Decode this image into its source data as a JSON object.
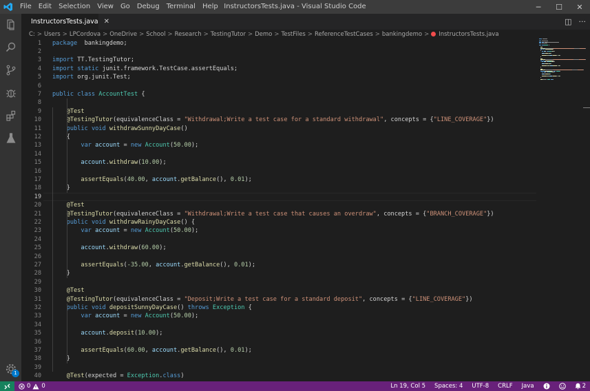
{
  "window": {
    "title": "InstructorsTests.java - Visual Studio Code",
    "menu": [
      "File",
      "Edit",
      "Selection",
      "View",
      "Go",
      "Debug",
      "Terminal",
      "Help"
    ],
    "controls": {
      "minimize": "─",
      "maximize": "☐",
      "close": "✕"
    }
  },
  "activitybar": {
    "icons": [
      "explorer-icon",
      "search-icon",
      "source-control-icon",
      "debug-icon",
      "extensions-icon",
      "testing-flask-icon",
      "manage-gear-icon"
    ],
    "gear_badge": "1"
  },
  "tab": {
    "label": "InstructorsTests.java",
    "close": "✕"
  },
  "editor_actions": {
    "split": "◫",
    "more": "···"
  },
  "breadcrumbs": [
    "C:",
    "Users",
    "LPCordova",
    "OneDrive",
    "School",
    "Research",
    "TestingTutor",
    "Demo",
    "TestFiles",
    "ReferenceTestCases",
    "bankingdemo",
    "InstructorsTests.java"
  ],
  "breadcrumb_separator": ">",
  "editor": {
    "active_line": 19,
    "lines": [
      {
        "n": 1,
        "t": [
          [
            "kw",
            "package"
          ],
          [
            "",
            "  bankingdemo;"
          ]
        ]
      },
      {
        "n": 2,
        "t": []
      },
      {
        "n": 3,
        "t": [
          [
            "kw",
            "import"
          ],
          [
            "",
            " TT.TestingTutor;"
          ]
        ]
      },
      {
        "n": 4,
        "t": [
          [
            "kw",
            "import"
          ],
          [
            "",
            " "
          ],
          [
            "kw",
            "static"
          ],
          [
            "",
            " junit.framework.TestCase.assertEquals;"
          ]
        ]
      },
      {
        "n": 5,
        "t": [
          [
            "kw",
            "import"
          ],
          [
            "",
            " org.junit.Test;"
          ]
        ]
      },
      {
        "n": 6,
        "t": []
      },
      {
        "n": 7,
        "t": [
          [
            "kw",
            "public"
          ],
          [
            "",
            " "
          ],
          [
            "kw",
            "class"
          ],
          [
            "",
            " "
          ],
          [
            "ty",
            "AccountTest"
          ],
          [
            "",
            " {"
          ]
        ]
      },
      {
        "n": 8,
        "t": []
      },
      {
        "n": 9,
        "t": [
          [
            "",
            "    "
          ],
          [
            "ann",
            "@Test"
          ]
        ]
      },
      {
        "n": 10,
        "t": [
          [
            "",
            "    "
          ],
          [
            "ann",
            "@TestingTutor"
          ],
          [
            "",
            "(equivalenceClass = "
          ],
          [
            "str",
            "\"Withdrawal;Write a test case for a standard withdrawal\""
          ],
          [
            "",
            ", concepts = {"
          ],
          [
            "str",
            "\"LINE_COVERAGE\""
          ],
          [
            "",
            "})"
          ]
        ]
      },
      {
        "n": 11,
        "t": [
          [
            "",
            "    "
          ],
          [
            "kw",
            "public"
          ],
          [
            "",
            " "
          ],
          [
            "kw",
            "void"
          ],
          [
            "",
            " "
          ],
          [
            "fn",
            "withdrawSunnyDayCase"
          ],
          [
            "",
            "()"
          ]
        ]
      },
      {
        "n": 12,
        "t": [
          [
            "",
            "    {"
          ]
        ]
      },
      {
        "n": 13,
        "t": [
          [
            "",
            "        "
          ],
          [
            "kw",
            "var"
          ],
          [
            "",
            " "
          ],
          [
            "var",
            "account"
          ],
          [
            "",
            " = "
          ],
          [
            "kw",
            "new"
          ],
          [
            "",
            " "
          ],
          [
            "ty",
            "Account"
          ],
          [
            "",
            "("
          ],
          [
            "num",
            "50.00"
          ],
          [
            "",
            ");"
          ]
        ]
      },
      {
        "n": 14,
        "t": []
      },
      {
        "n": 15,
        "t": [
          [
            "",
            "        "
          ],
          [
            "var",
            "account"
          ],
          [
            "",
            "."
          ],
          [
            "fn",
            "withdraw"
          ],
          [
            "",
            "("
          ],
          [
            "num",
            "10.00"
          ],
          [
            "",
            ");"
          ]
        ]
      },
      {
        "n": 16,
        "t": []
      },
      {
        "n": 17,
        "t": [
          [
            "",
            "        "
          ],
          [
            "fn",
            "assertEquals"
          ],
          [
            "",
            "("
          ],
          [
            "num",
            "40.00"
          ],
          [
            "",
            ", "
          ],
          [
            "var",
            "account"
          ],
          [
            "",
            "."
          ],
          [
            "fn",
            "getBalance"
          ],
          [
            "",
            "(), "
          ],
          [
            "num",
            "0.01"
          ],
          [
            "",
            ");"
          ]
        ]
      },
      {
        "n": 18,
        "t": [
          [
            "",
            "    }"
          ]
        ]
      },
      {
        "n": 19,
        "t": []
      },
      {
        "n": 20,
        "t": [
          [
            "",
            "    "
          ],
          [
            "ann",
            "@Test"
          ]
        ]
      },
      {
        "n": 21,
        "t": [
          [
            "",
            "    "
          ],
          [
            "ann",
            "@TestingTutor"
          ],
          [
            "",
            "(equivalenceClass = "
          ],
          [
            "str",
            "\"Withdrawal;Write a test case that causes an overdraw\""
          ],
          [
            "",
            ", concepts = {"
          ],
          [
            "str",
            "\"BRANCH_COVERAGE\""
          ],
          [
            "",
            "})"
          ]
        ]
      },
      {
        "n": 22,
        "t": [
          [
            "",
            "    "
          ],
          [
            "kw",
            "public"
          ],
          [
            "",
            " "
          ],
          [
            "kw",
            "void"
          ],
          [
            "",
            " "
          ],
          [
            "fn",
            "withdrawRainyDayCase"
          ],
          [
            "",
            "() {"
          ]
        ]
      },
      {
        "n": 23,
        "t": [
          [
            "",
            "        "
          ],
          [
            "kw",
            "var"
          ],
          [
            "",
            " "
          ],
          [
            "var",
            "account"
          ],
          [
            "",
            " = "
          ],
          [
            "kw",
            "new"
          ],
          [
            "",
            " "
          ],
          [
            "ty",
            "Account"
          ],
          [
            "",
            "("
          ],
          [
            "num",
            "50.00"
          ],
          [
            "",
            ");"
          ]
        ]
      },
      {
        "n": 24,
        "t": []
      },
      {
        "n": 25,
        "t": [
          [
            "",
            "        "
          ],
          [
            "var",
            "account"
          ],
          [
            "",
            "."
          ],
          [
            "fn",
            "withdraw"
          ],
          [
            "",
            "("
          ],
          [
            "num",
            "60.00"
          ],
          [
            "",
            ");"
          ]
        ]
      },
      {
        "n": 26,
        "t": []
      },
      {
        "n": 27,
        "t": [
          [
            "",
            "        "
          ],
          [
            "fn",
            "assertEquals"
          ],
          [
            "",
            "("
          ],
          [
            "num",
            "-35.00"
          ],
          [
            "",
            ", "
          ],
          [
            "var",
            "account"
          ],
          [
            "",
            "."
          ],
          [
            "fn",
            "getBalance"
          ],
          [
            "",
            "(), "
          ],
          [
            "num",
            "0.01"
          ],
          [
            "",
            ");"
          ]
        ]
      },
      {
        "n": 28,
        "t": [
          [
            "",
            "    }"
          ]
        ]
      },
      {
        "n": 29,
        "t": []
      },
      {
        "n": 30,
        "t": [
          [
            "",
            "    "
          ],
          [
            "ann",
            "@Test"
          ]
        ]
      },
      {
        "n": 31,
        "t": [
          [
            "",
            "    "
          ],
          [
            "ann",
            "@TestingTutor"
          ],
          [
            "",
            "(equivalenceClass = "
          ],
          [
            "str",
            "\"Deposit;Write a test case for a standard deposit\""
          ],
          [
            "",
            ", concepts = {"
          ],
          [
            "str",
            "\"LINE_COVERAGE\""
          ],
          [
            "",
            "})"
          ]
        ]
      },
      {
        "n": 32,
        "t": [
          [
            "",
            "    "
          ],
          [
            "kw",
            "public"
          ],
          [
            "",
            " "
          ],
          [
            "kw",
            "void"
          ],
          [
            "",
            " "
          ],
          [
            "fn",
            "depositSunnyDayCase"
          ],
          [
            "",
            "() "
          ],
          [
            "kw",
            "throws"
          ],
          [
            "",
            " "
          ],
          [
            "ty",
            "Exception"
          ],
          [
            "",
            " {"
          ]
        ]
      },
      {
        "n": 33,
        "t": [
          [
            "",
            "        "
          ],
          [
            "kw",
            "var"
          ],
          [
            "",
            " "
          ],
          [
            "var",
            "account"
          ],
          [
            "",
            " = "
          ],
          [
            "kw",
            "new"
          ],
          [
            "",
            " "
          ],
          [
            "ty",
            "Account"
          ],
          [
            "",
            "("
          ],
          [
            "num",
            "50.00"
          ],
          [
            "",
            ");"
          ]
        ]
      },
      {
        "n": 34,
        "t": []
      },
      {
        "n": 35,
        "t": [
          [
            "",
            "        "
          ],
          [
            "var",
            "account"
          ],
          [
            "",
            "."
          ],
          [
            "fn",
            "deposit"
          ],
          [
            "",
            "("
          ],
          [
            "num",
            "10.00"
          ],
          [
            "",
            ");"
          ]
        ]
      },
      {
        "n": 36,
        "t": []
      },
      {
        "n": 37,
        "t": [
          [
            "",
            "        "
          ],
          [
            "fn",
            "assertEquals"
          ],
          [
            "",
            "("
          ],
          [
            "num",
            "60.00"
          ],
          [
            "",
            ", "
          ],
          [
            "var",
            "account"
          ],
          [
            "",
            "."
          ],
          [
            "fn",
            "getBalance"
          ],
          [
            "",
            "(), "
          ],
          [
            "num",
            "0.01"
          ],
          [
            "",
            ");"
          ]
        ]
      },
      {
        "n": 38,
        "t": [
          [
            "",
            "    }"
          ]
        ]
      },
      {
        "n": 39,
        "t": []
      },
      {
        "n": 40,
        "t": [
          [
            "",
            "    "
          ],
          [
            "ann",
            "@Test"
          ],
          [
            "",
            "(expected = "
          ],
          [
            "ty",
            "Exception"
          ],
          [
            "",
            "."
          ],
          [
            "kw",
            "class"
          ],
          [
            "",
            ")"
          ]
        ]
      }
    ]
  },
  "statusbar": {
    "errors": "0",
    "warnings": "0",
    "position": "Ln 19, Col 5",
    "spaces": "Spaces: 4",
    "encoding": "UTF-8",
    "eol": "CRLF",
    "language": "Java",
    "notifications": "2"
  },
  "colors": {
    "titlebar": "#3c3c3c",
    "activitybar": "#333333",
    "editor_bg": "#1e1e1e",
    "statusbar": "#68217a",
    "remote": "#16825d",
    "error": "#f14c4c"
  }
}
